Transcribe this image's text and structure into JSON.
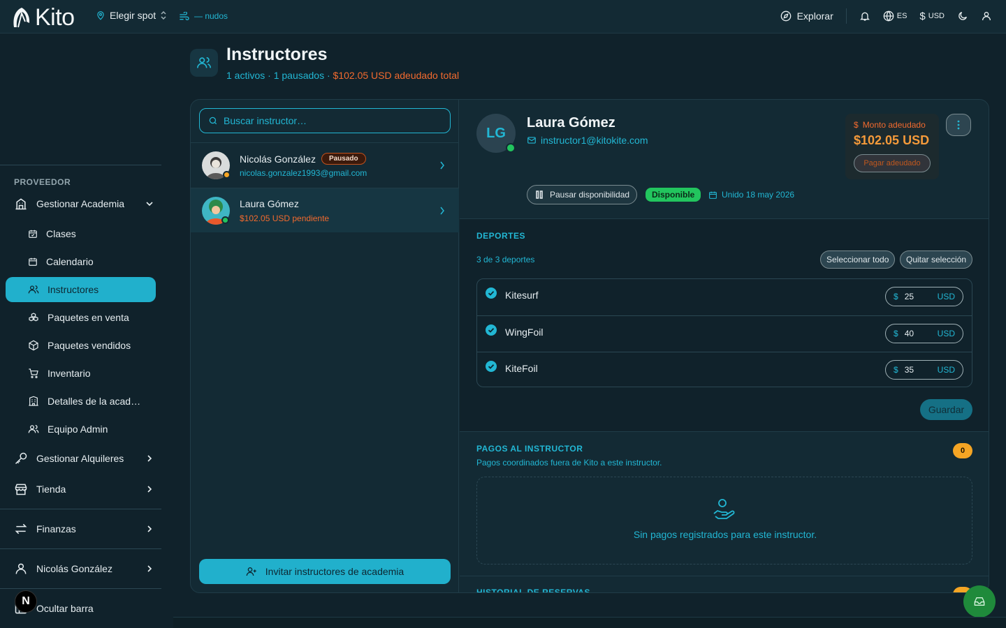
{
  "brand": {
    "name": "Kito"
  },
  "topbar": {
    "spot_label": "Elegir spot",
    "wind_unit": "— nudos",
    "explore": "Explorar",
    "lang": "ES",
    "currency": "USD"
  },
  "sidebar": {
    "section": "PROVEEDOR",
    "manage_academy": "Gestionar Academia",
    "items": [
      {
        "label": "Clases"
      },
      {
        "label": "Calendario"
      },
      {
        "label": "Instructores"
      },
      {
        "label": "Paquetes en venta"
      },
      {
        "label": "Paquetes vendidos"
      },
      {
        "label": "Inventario"
      },
      {
        "label": "Detalles de la acad…"
      },
      {
        "label": "Equipo Admin"
      }
    ],
    "manage_rentals": "Gestionar Alquileres",
    "store": "Tienda",
    "finance": "Finanzas",
    "user": "Nicolás González",
    "hide_bar": "Ocultar barra",
    "avatar_letter": "N"
  },
  "page": {
    "title": "Instructores",
    "summary": "1 activos · 1 pausados · ",
    "owed_total": "$102.05 USD adeudado total"
  },
  "list": {
    "search_placeholder": "Buscar instructor…",
    "instructors": [
      {
        "name": "Nicolás González",
        "badge": "Pausado",
        "meta": "nicolas.gonzalez1993@gmail.com"
      },
      {
        "name": "Laura Gómez",
        "meta": "$102.05 USD pendiente"
      }
    ],
    "invite": "Invitar instructores de academia"
  },
  "detail": {
    "initials": "LG",
    "name": "Laura Gómez",
    "email": "instructor1@kitokite.com",
    "owed_label": "Monto adeudado",
    "owed_value": "$102.05 USD",
    "owed_button": "Pagar adeudado",
    "pause": "Pausar disponibilidad",
    "status": "Disponible",
    "joined": "Unido 18 may 2026",
    "sports_title": "DEPORTES",
    "sports_count": "3 de 3 deportes",
    "select_all": "Seleccionar todo",
    "clear_selection": "Quitar selección",
    "sports": [
      {
        "name": "Kitesurf",
        "price": "25",
        "currency": "USD"
      },
      {
        "name": "WingFoil",
        "price": "40",
        "currency": "USD"
      },
      {
        "name": "KiteFoil",
        "price": "35",
        "currency": "USD"
      }
    ],
    "save": "Guardar",
    "payments_title": "PAGOS AL INSTRUCTOR",
    "payments_sub": "Pagos coordinados fuera de Kito a este instructor.",
    "payments_count": "0",
    "payments_empty": "Sin pagos registrados para este instructor.",
    "history_title": "HISTORIAL DE RESERVAS"
  },
  "colors": {
    "accent": "#21b0cc",
    "owed": "#f26a2e",
    "available": "#22c55e",
    "bg": "#10222b"
  }
}
